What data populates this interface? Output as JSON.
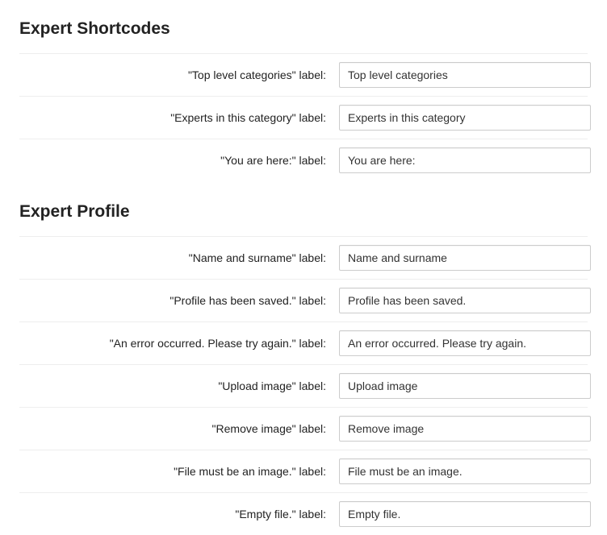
{
  "sections": {
    "shortcodes": {
      "heading": "Expert Shortcodes",
      "rows": [
        {
          "label": "\"Top level categories\" label:",
          "value": "Top level categories"
        },
        {
          "label": "\"Experts in this category\" label:",
          "value": "Experts in this category"
        },
        {
          "label": "\"You are here:\" label:",
          "value": "You are here:"
        }
      ]
    },
    "profile": {
      "heading": "Expert Profile",
      "rows": [
        {
          "label": "\"Name and surname\" label:",
          "value": "Name and surname"
        },
        {
          "label": "\"Profile has been saved.\" label:",
          "value": "Profile has been saved."
        },
        {
          "label": "\"An error occurred. Please try again.\" label:",
          "value": "An error occurred. Please try again."
        },
        {
          "label": "\"Upload image\" label:",
          "value": "Upload image"
        },
        {
          "label": "\"Remove image\" label:",
          "value": "Remove image"
        },
        {
          "label": "\"File must be an image.\" label:",
          "value": "File must be an image."
        },
        {
          "label": "\"Empty file.\" label:",
          "value": "Empty file."
        }
      ]
    }
  }
}
